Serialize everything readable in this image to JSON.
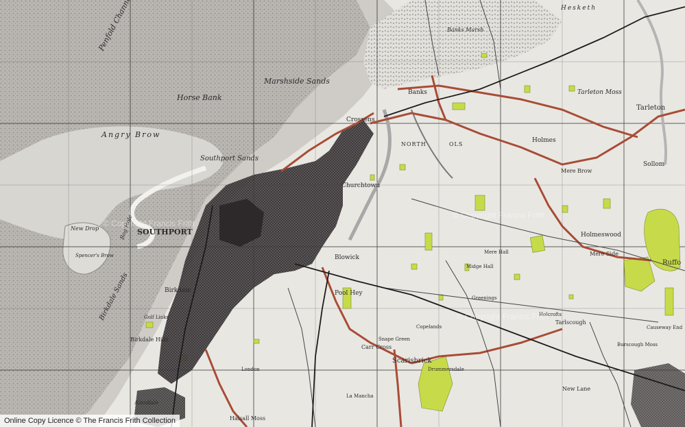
{
  "map": {
    "town_labels": {
      "southport": "SOUTHPORT",
      "birkdale": "Birkdale",
      "ainsdale": "Ainsdale",
      "churchtown": "Churchtown",
      "crossens": "Crossens",
      "blowick": "Blowick",
      "scarisbrick": "Scarisbrick",
      "tarleton": "Tarleton",
      "hesketh": "Hesketh",
      "holmes": "Holmes",
      "holmeswood": "Holmeswood",
      "sollom": "Sollom",
      "banks": "Banks",
      "north_meols": "NORTH",
      "meols": "OLS",
      "pool_hey": "Pool Hey",
      "carr_cross": "Carr Cross",
      "snape_green": "Snape Green",
      "mere_brow": "Mere Brow",
      "mere_side": "Mere Side",
      "tarlscough": "Tarlscough",
      "holcrofts": "Holcrofts",
      "new_lane": "New Lane",
      "burscough_moss": "Burscough Moss",
      "drummersdale": "Drummersdale",
      "copelands": "Copelands",
      "halsall_moss": "Halsall Moss",
      "la_mancha": "La Mancha",
      "london": "London",
      "birkdale_hills": "Birkdale Hills",
      "golf_links": "Golf Links",
      "greenings": "Greenings",
      "midge_hall": "Midge Hall",
      "mere_hall": "Mere Hall",
      "causeway_end": "Causeway End",
      "rufford": "Ruffo"
    },
    "sea_labels": {
      "penfold_channel": "Penfold Channel",
      "horse_bank": "Horse Bank",
      "angry_brow": "Angry Brow",
      "southport_sands": "Southport Sands",
      "marshside_sands": "Marshside Sands",
      "banks_marsh": "Banks Marsh",
      "birkdale_sands": "Birkdale Sands",
      "new_drop": "New Drop",
      "spencers_brow": "Spencer's Brow",
      "bog_hole": "Bog Hole",
      "tarleton_moss": "Tarleton Moss"
    },
    "watermark": "© Copyright Francis Frith",
    "colors": {
      "paper": "#e9e7e2",
      "grid": "#222222",
      "road": "#a84c36",
      "urban": "#3a3638",
      "wood": "#c7db4a",
      "water": "#9f9f9f",
      "rail": "#1c1c1c"
    }
  },
  "footer": {
    "copyright": "Online Copy Licence   © The Francis Frith Collection"
  }
}
